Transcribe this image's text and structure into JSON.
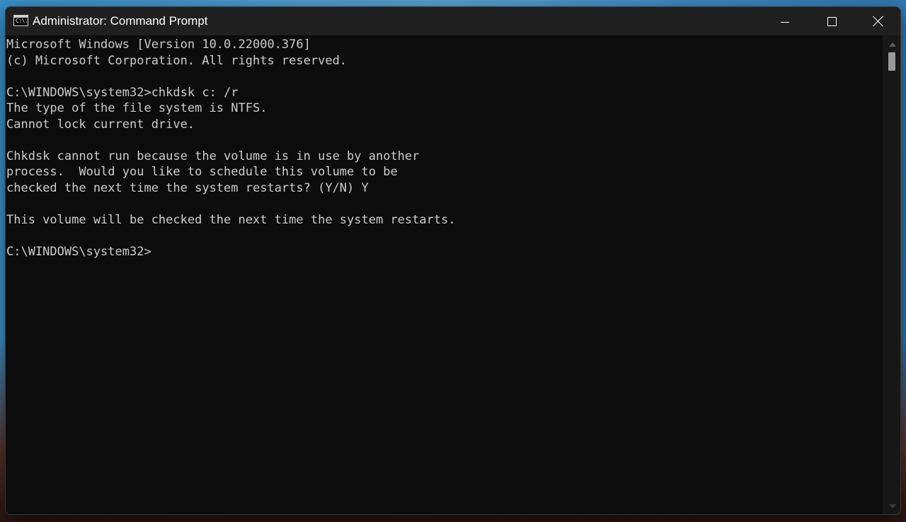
{
  "window": {
    "title": "Administrator: Command Prompt",
    "app_icon_text": "C:\\."
  },
  "controls": {
    "minimize": "minimize",
    "maximize": "maximize",
    "close": "close"
  },
  "console": {
    "lines": [
      "Microsoft Windows [Version 10.0.22000.376]",
      "(c) Microsoft Corporation. All rights reserved.",
      "",
      "C:\\WINDOWS\\system32>chkdsk c: /r",
      "The type of the file system is NTFS.",
      "Cannot lock current drive.",
      "",
      "Chkdsk cannot run because the volume is in use by another",
      "process.  Would you like to schedule this volume to be",
      "checked the next time the system restarts? (Y/N) Y",
      "",
      "This volume will be checked the next time the system restarts.",
      "",
      "C:\\WINDOWS\\system32>"
    ],
    "text_color": "#cccccc",
    "background_color": "#0c0c0c"
  }
}
